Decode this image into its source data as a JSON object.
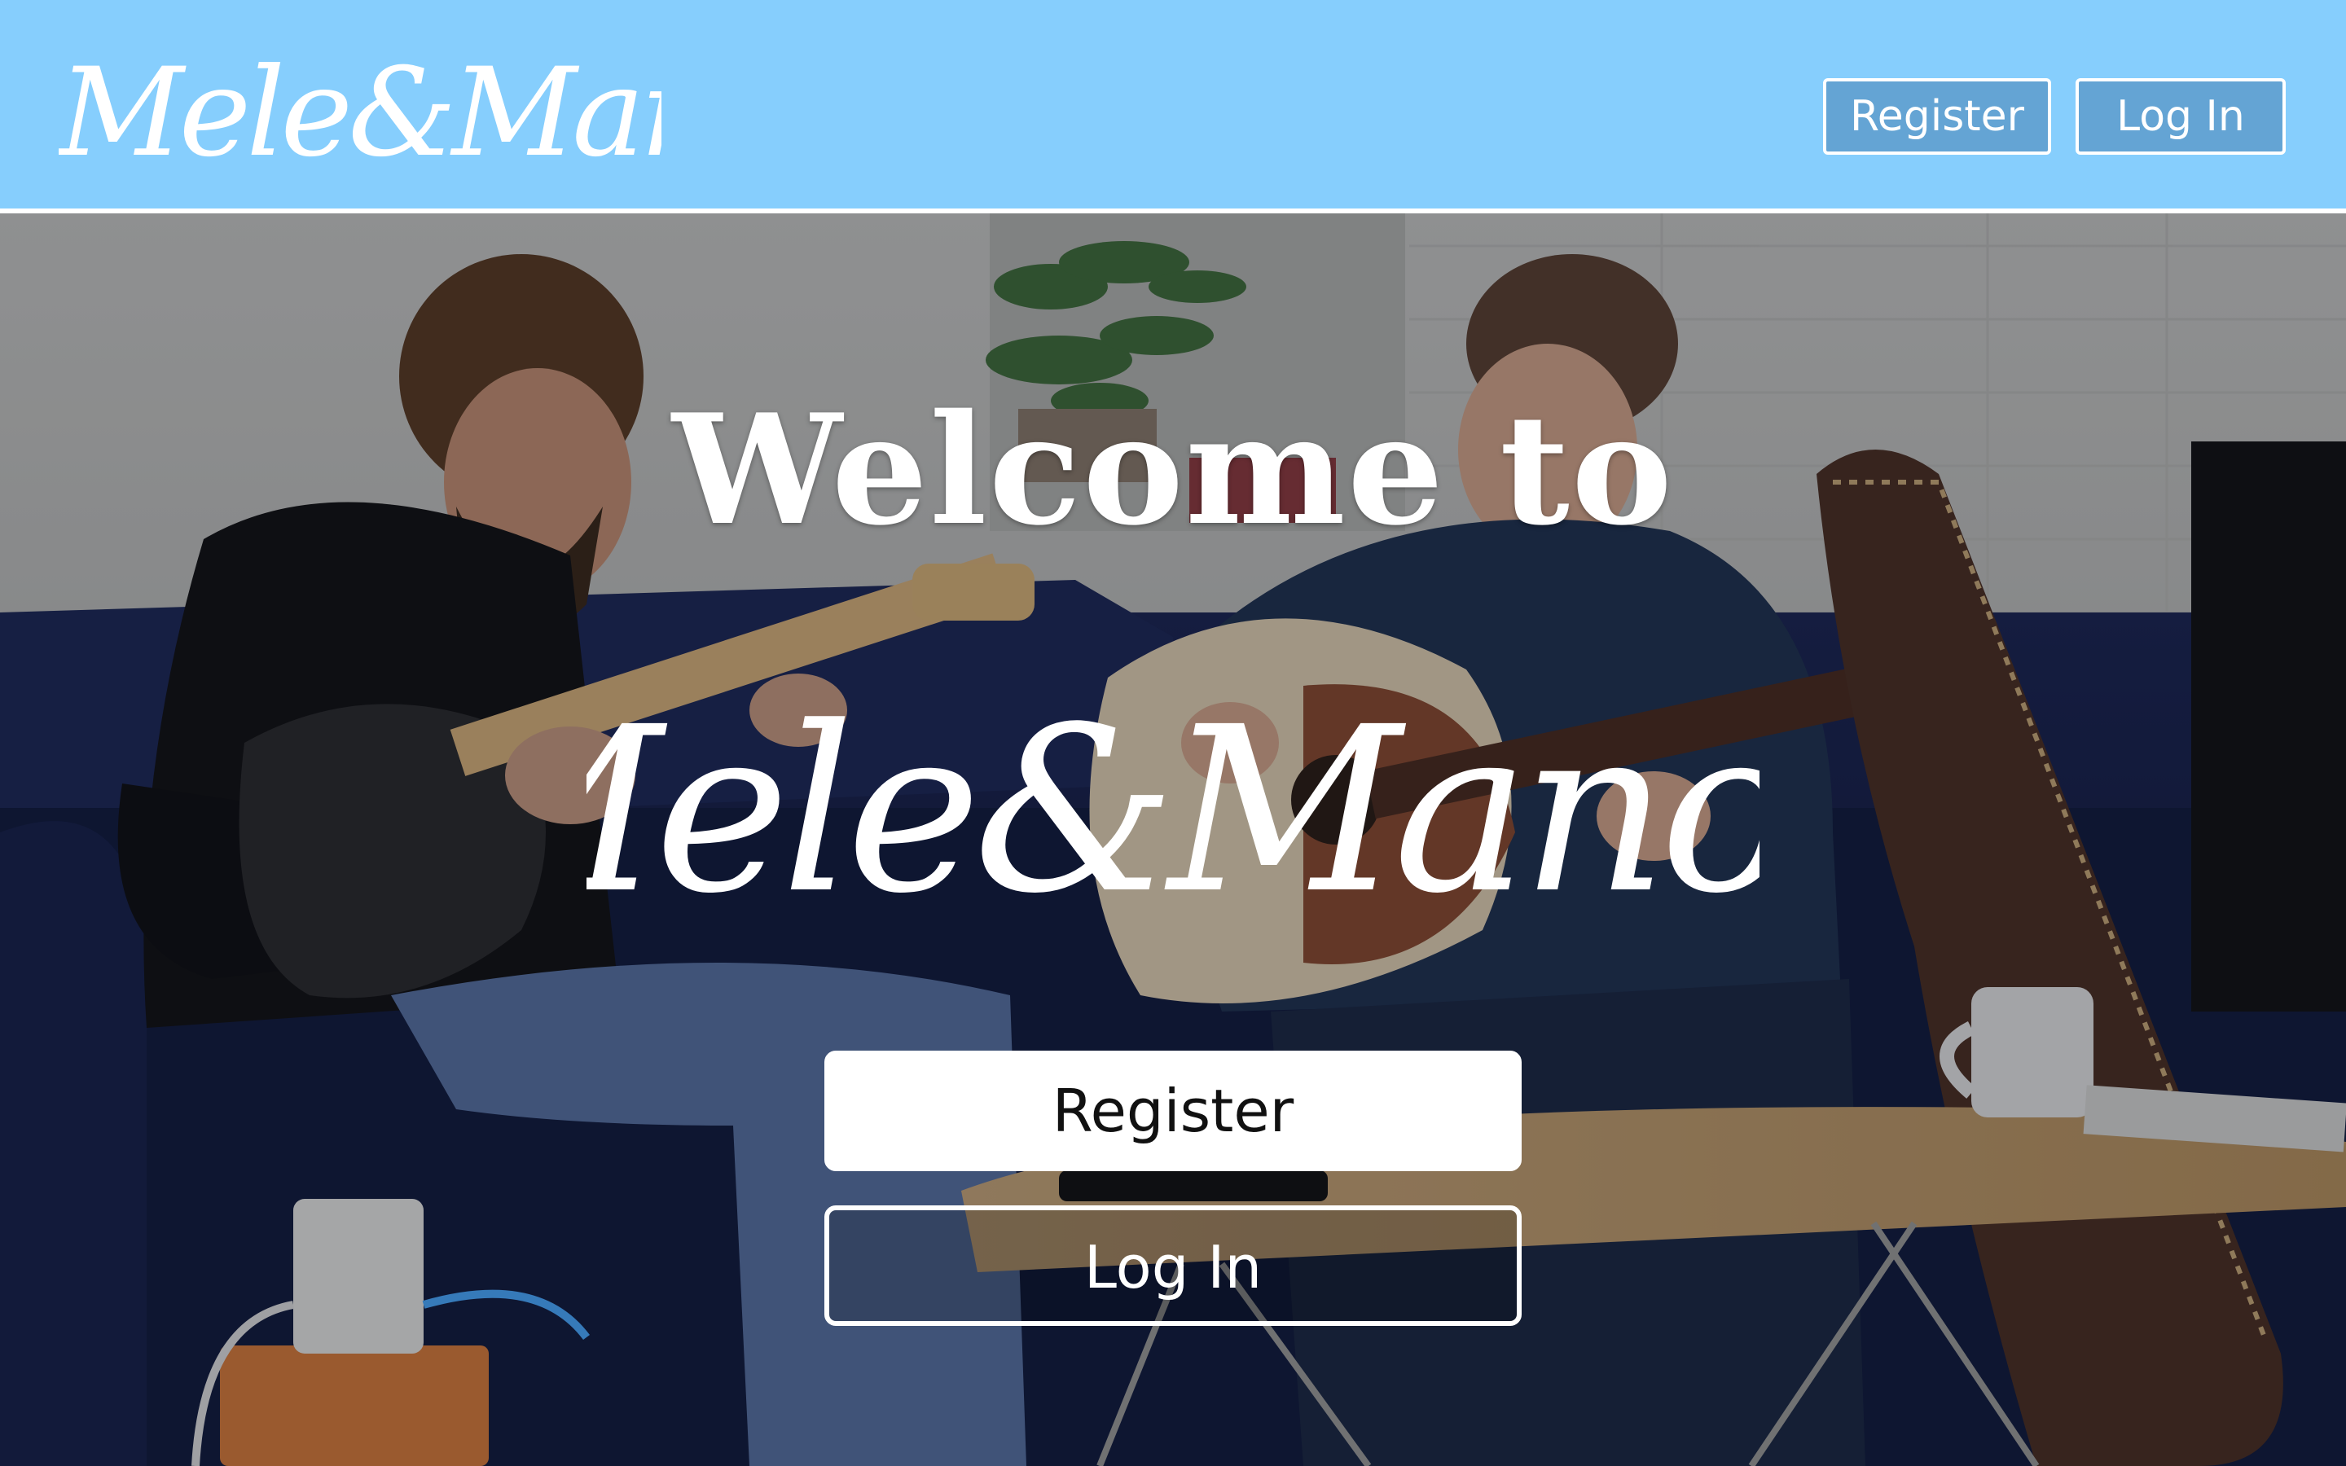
{
  "brand": {
    "logo_text": "Mele&Manoa",
    "nav_color": "#86cefd"
  },
  "navbar": {
    "register_label": "Register",
    "login_label": "Log In"
  },
  "hero": {
    "title": "Welcome to",
    "logo_text": "Mele&Manoa",
    "register_label": "Register",
    "login_label": "Log In",
    "photo_description_icon": "guitarists-photo"
  }
}
